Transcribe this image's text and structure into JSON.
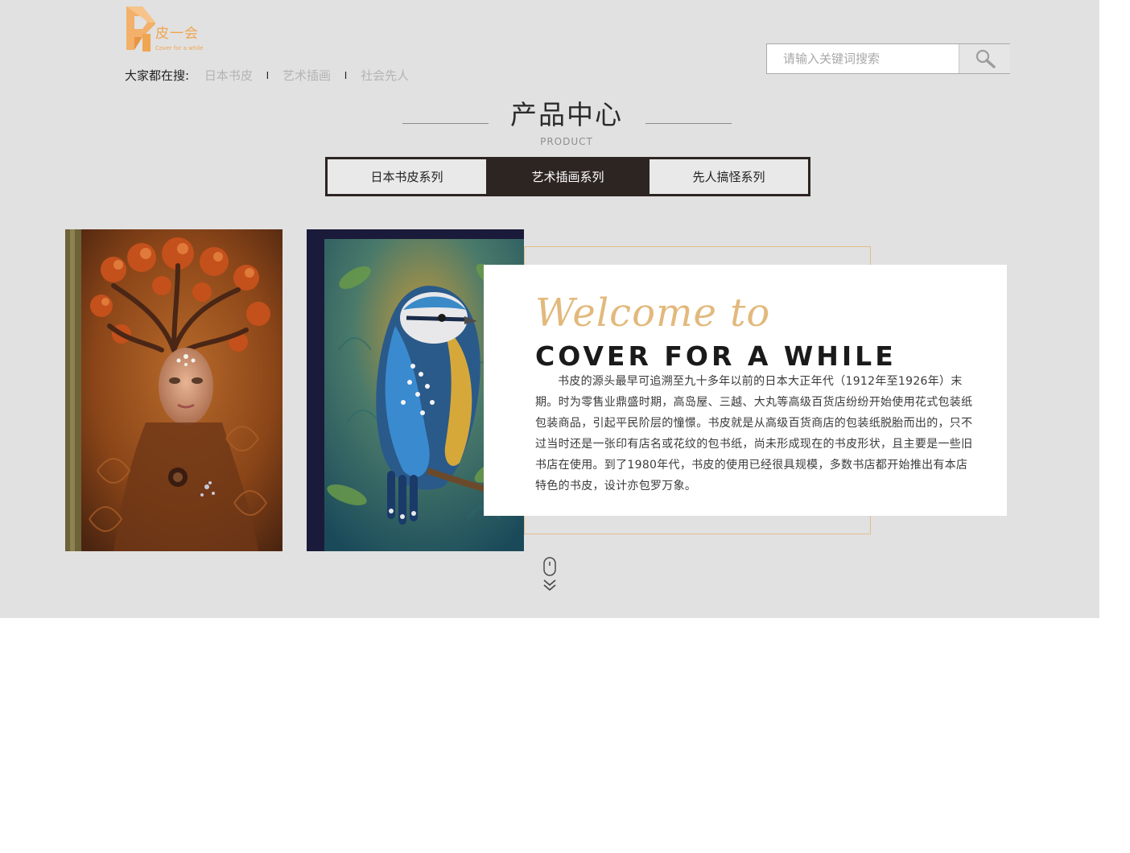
{
  "brand": {
    "name": "皮一会",
    "subtitle": "Cover for a while",
    "logo_letter_icon": "logo-p-icon",
    "accent_color": "#f0a550"
  },
  "hot_search": {
    "label": "大家都在搜:",
    "items": [
      "日本书皮",
      "艺术插画",
      "社会先人"
    ],
    "separator": "I"
  },
  "search": {
    "placeholder": "请输入关键词搜索",
    "value": "",
    "button_icon": "search-icon"
  },
  "section": {
    "title": "产品中心",
    "subtitle": "PRODUCT"
  },
  "tabs": [
    {
      "label": "日本书皮系列",
      "active": false
    },
    {
      "label": "艺术插画系列",
      "active": true
    },
    {
      "label": "先人搞怪系列",
      "active": false
    }
  ],
  "gallery": [
    {
      "image": "tree-woman-leather-book-cover"
    },
    {
      "image": "bluebird-leather-book-cover"
    }
  ],
  "welcome_card": {
    "script_heading": "Welcome to",
    "heading": "COVER FOR A WHILE",
    "body": "书皮的源头最早可追溯至九十多年以前的日本大正年代（1912年至1926年）末期。时为零售业鼎盛时期，高岛屋、三越、大丸等高级百货店纷纷开始使用花式包装纸包装商品，引起平民阶层的憧憬。书皮就是从高级百货商店的包装纸脱胎而出的，只不过当时还是一张印有店名或花纹的包书纸，尚未形成现在的书皮形状，且主要是一些旧书店在使用。到了1980年代，书皮的使用已经很具规模，多数书店都开始推出有本店特色的书皮，设计亦包罗万象。",
    "frame_color": "#e5be8a",
    "script_color": "#e2b97d"
  },
  "scroll_hint": {
    "icons": [
      "mouse-icon",
      "double-chevron-down-icon"
    ]
  },
  "colors": {
    "background": "#e1e1e1",
    "dark": "#2d2522"
  }
}
